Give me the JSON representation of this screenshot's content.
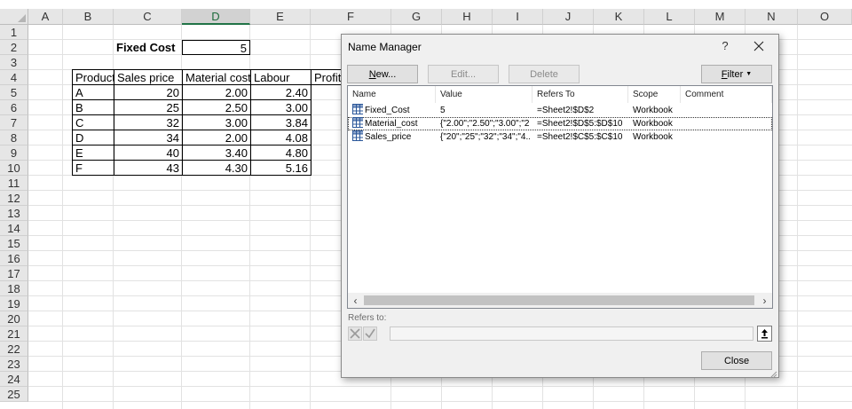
{
  "sheet": {
    "columns": [
      "A",
      "B",
      "C",
      "D",
      "E",
      "F",
      "G",
      "H",
      "I",
      "J",
      "K",
      "L",
      "M",
      "N",
      "O"
    ],
    "selected_column": "D",
    "rows": [
      "1",
      "2",
      "3",
      "4",
      "5",
      "6",
      "7",
      "8",
      "9",
      "10",
      "11",
      "12",
      "13",
      "14",
      "15",
      "16",
      "17",
      "18",
      "19",
      "20",
      "21",
      "22",
      "23",
      "24",
      "25"
    ],
    "fixed_cost_label": "Fixed Cost",
    "fixed_cost_value": "5",
    "table_headers": [
      "Product",
      "Sales price",
      "Material cost",
      "Labour",
      "Profit"
    ],
    "table_rows": [
      [
        "A",
        "20",
        "2.00",
        "2.40"
      ],
      [
        "B",
        "25",
        "2.50",
        "3.00"
      ],
      [
        "C",
        "32",
        "3.00",
        "3.84"
      ],
      [
        "D",
        "34",
        "2.00",
        "4.08"
      ],
      [
        "E",
        "40",
        "3.40",
        "4.80"
      ],
      [
        "F",
        "43",
        "4.30",
        "5.16"
      ]
    ]
  },
  "dialog": {
    "title": "Name Manager",
    "help_label": "?",
    "buttons": {
      "new": {
        "pre": "",
        "u": "N",
        "post": "ew..."
      },
      "edit": "Edit...",
      "delete": "Delete",
      "filter": {
        "pre": "",
        "u": "F",
        "post": "ilter"
      },
      "close": "Close"
    },
    "list": {
      "headers": [
        "Name",
        "Value",
        "Refers To",
        "Scope",
        "Comment"
      ],
      "rows": [
        {
          "name": "Fixed_Cost",
          "value": "5",
          "refers": "=Sheet2!$D$2",
          "scope": "Workbook",
          "comment": ""
        },
        {
          "name": "Material_cost",
          "value": "{\"2.00\";\"2.50\";\"3.00\";\"2...",
          "refers": "=Sheet2!$D$5:$D$10",
          "scope": "Workbook",
          "comment": ""
        },
        {
          "name": "Sales_price",
          "value": "{\"20\";\"25\";\"32\";\"34\";\"4...",
          "refers": "=Sheet2!$C$5:$C$10",
          "scope": "Workbook",
          "comment": ""
        }
      ],
      "focused_row": 1
    },
    "refers_to_label": "Refers to:",
    "refers_to_value": ""
  }
}
